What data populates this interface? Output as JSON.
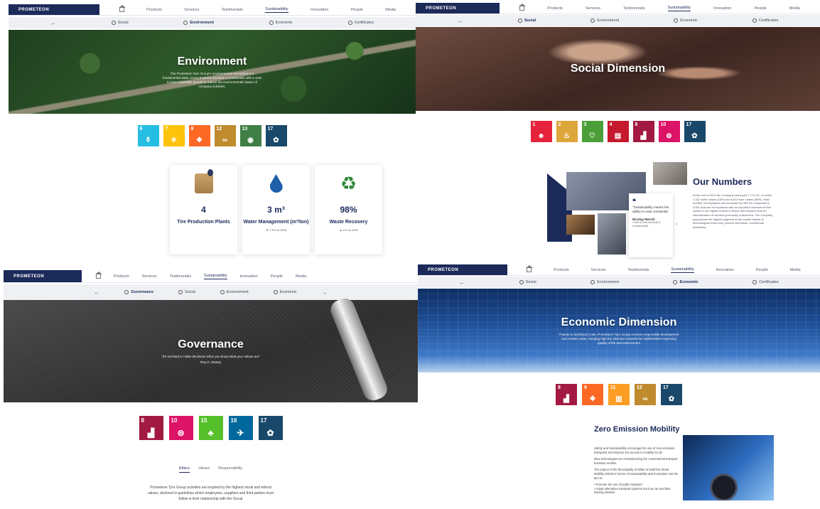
{
  "brand": "PROMETEON",
  "nav": {
    "items": [
      "Products",
      "Services",
      "Testimonials",
      "Sustainability",
      "Innovation",
      "People",
      "Media"
    ],
    "active": "Sustainability"
  },
  "environment": {
    "subnav": [
      "Social",
      "Environment",
      "Economic",
      "Certificates"
    ],
    "title": "Environment",
    "text": "The Prometeon Tyre Group's environmental orientation is a fundamental value. Every business decision is sustainable with a view to eco-compatible growth to reduce the environmental impact of company activities.",
    "sdgs": [
      {
        "num": "6",
        "color": "#26bde2",
        "icon": "water-tap-icon"
      },
      {
        "num": "7",
        "color": "#fcc30b",
        "icon": "sun-icon"
      },
      {
        "num": "9",
        "color": "#fd6925",
        "icon": "cubes-icon"
      },
      {
        "num": "12",
        "color": "#bf8b2e",
        "icon": "infinity-icon"
      },
      {
        "num": "13",
        "color": "#3f7e44",
        "icon": "eye-icon"
      },
      {
        "num": "17",
        "color": "#19486a",
        "icon": "flower-icon"
      }
    ],
    "cards": [
      {
        "value": "4",
        "label": "Tire Production Plants",
        "delta": ""
      },
      {
        "value": "3 m³",
        "label": "Water Management (m³/ton)",
        "delta": "▼ 7.4% vs 2018"
      },
      {
        "value": "98%",
        "label": "Waste Recovery",
        "delta": "▲ 1% vs 2018"
      }
    ]
  },
  "social": {
    "subnav": [
      "Social",
      "Environment",
      "Economic",
      "Certificates"
    ],
    "title": "Social Dimension",
    "sdgs": [
      {
        "num": "1",
        "color": "#e5243b",
        "icon": "people-icon"
      },
      {
        "num": "2",
        "color": "#dda63a",
        "icon": "bowl-icon"
      },
      {
        "num": "3",
        "color": "#4c9f38",
        "icon": "heartbeat-icon"
      },
      {
        "num": "4",
        "color": "#c5192d",
        "icon": "book-icon"
      },
      {
        "num": "8",
        "color": "#a21942",
        "icon": "chart-icon"
      },
      {
        "num": "10",
        "color": "#dd1367",
        "icon": "equal-icon"
      },
      {
        "num": "17",
        "color": "#19486a",
        "icon": "flower-icon"
      }
    ],
    "numbers_title": "Our Numbers",
    "numbers_text": "At the end of 2019 the Company employed 7,771 HC, of which 1,152 white collars (15%) and 6,619 blue collars (85%). Total number of employees has increased by 398 HC compared to 2018, that can be explained with an important increase of blue collars in our logistic branch in Brazil, that resulted from an internalization of services previously outsourced. The Company approaches the highest segment of the market thanks to technological know-how, product innovation, commercial leadership.",
    "quote": "\"Sustainability means the ability to exist constantly\"",
    "quote_author": "Nicolay Marchi",
    "quote_role": "Chief of Internal Audit & Sustainability"
  },
  "governance": {
    "subnav": [
      "Governance",
      "Social",
      "Environment",
      "Economic"
    ],
    "title": "Governance",
    "quote": "\"It's not hard to make decisions when you know what your values are\"",
    "author": "Roy O. Disney",
    "sdgs": [
      {
        "num": "8",
        "color": "#a21942",
        "icon": "chart-icon"
      },
      {
        "num": "10",
        "color": "#dd1367",
        "icon": "equal-icon"
      },
      {
        "num": "15",
        "color": "#56c02b",
        "icon": "tree-icon"
      },
      {
        "num": "16",
        "color": "#00689d",
        "icon": "dove-icon"
      },
      {
        "num": "17",
        "color": "#19486a",
        "icon": "flower-icon"
      }
    ],
    "tabs": [
      "Ethics",
      "Values",
      "Responsibility"
    ],
    "active_tab": "Ethics",
    "text": "Prometeon Tyre Group activities are inspired by the highest moral and ethical values, declined in guidelines which employees, suppliers and third parties must follow in their relationship with the Group"
  },
  "economic": {
    "subnav": [
      "Social",
      "Environment",
      "Economic",
      "Certificates"
    ],
    "title": "Economic Dimension",
    "text": "Thanks to its Ethical Code, Prometeon Tyre Group ensures responsible development and creates value, bringing high the attention towards the stakeholders improving quality of life and environment",
    "sdgs": [
      {
        "num": "8",
        "color": "#a21942",
        "icon": "chart-icon"
      },
      {
        "num": "9",
        "color": "#fd6925",
        "icon": "cubes-icon"
      },
      {
        "num": "11",
        "color": "#fd9d24",
        "icon": "city-icon"
      },
      {
        "num": "12",
        "color": "#bf8b2e",
        "icon": "infinity-icon"
      },
      {
        "num": "17",
        "color": "#19486a",
        "icon": "flower-icon"
      }
    ],
    "zem_title": "Zero Emission Mobility",
    "zem_p1": "Safety and Sustainability encourage the use of zero-emission transports and improve the access to mobility for all.",
    "zem_p2": "New technologies are revolutionizing the conventional transport business models.",
    "zem_p3": "The project of the Municipality of Milan to build the Smart Mobility District in terms of Sustainability and Innovation has the aim to:",
    "zem_b1": "• Promote the use of public transport",
    "zem_b2": "• Adapt alternative transport systems such as car and bike sharing stations"
  }
}
